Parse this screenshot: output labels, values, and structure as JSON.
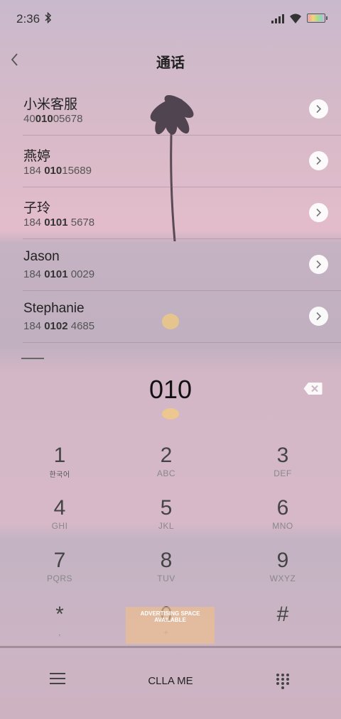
{
  "status_bar": {
    "time": "2:36",
    "bluetooth_icon": "bluetooth-icon",
    "signal_icon": "signal-icon",
    "wifi_icon": "wifi-icon",
    "battery_icon": "battery-icon"
  },
  "header": {
    "title": "通话",
    "back_icon": "chevron-left-icon"
  },
  "contacts": [
    {
      "name": "小米客服",
      "number_pre": "40",
      "number_match": "010",
      "number_post": "05678"
    },
    {
      "name": "燕婷",
      "number_pre": "184 ",
      "number_match": "010",
      "number_post": "15689"
    },
    {
      "name": "子玲",
      "number_pre": "184 ",
      "number_match": "0101",
      "number_post": " 5678"
    },
    {
      "name": "Jason",
      "number_pre": "184 ",
      "number_match": "0101",
      "number_post": " 0029"
    },
    {
      "name": "Stephanie",
      "number_pre": "184 ",
      "number_match": "0102",
      "number_post": " 4685"
    }
  ],
  "dialer": {
    "input_value": "010",
    "delete_icon": "backspace-icon"
  },
  "keypad": [
    {
      "digit": "1",
      "letters": "한국어"
    },
    {
      "digit": "2",
      "letters": "ABC"
    },
    {
      "digit": "3",
      "letters": "DEF"
    },
    {
      "digit": "4",
      "letters": "GHI"
    },
    {
      "digit": "5",
      "letters": "JKL"
    },
    {
      "digit": "6",
      "letters": "MNO"
    },
    {
      "digit": "7",
      "letters": "PQRS"
    },
    {
      "digit": "8",
      "letters": "TUV"
    },
    {
      "digit": "9",
      "letters": "WXYZ"
    },
    {
      "digit": "*",
      "letters": ","
    },
    {
      "digit": "0",
      "letters": "+"
    },
    {
      "digit": "#",
      "letters": ""
    }
  ],
  "bottom_bar": {
    "menu_icon": "menu-icon",
    "call_label": "CLLA ME",
    "keypad_icon": "dialpad-icon"
  },
  "billboard": {
    "line1": "ADVERTISING SPACE",
    "line2": "AVAILABLE"
  },
  "colors": {
    "background_top": "#c9b9cc",
    "background_pink": "#e3bccb",
    "text_primary": "#222222",
    "detail_button": "#ffffff"
  }
}
